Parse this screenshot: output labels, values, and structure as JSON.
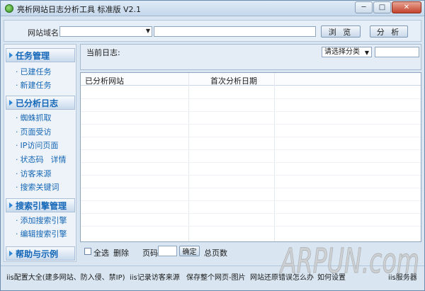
{
  "window": {
    "title": "亮析网站日志分析工具 标准版 V2.1",
    "minimize": "─",
    "maximize": "□",
    "close": "✕"
  },
  "toolbar": {
    "site_label": "网站域名:",
    "site_value": "",
    "browse_label": "浏 览",
    "analyze_label": "分 析"
  },
  "sidebar": {
    "sections": [
      {
        "title": "任务管理",
        "items": [
          "已建任务",
          "新建任务"
        ]
      },
      {
        "title": "已分析日志",
        "items": [
          "蜘蛛抓取",
          "页面受访",
          "IP访问页面",
          "状态码",
          "访客来源",
          "搜索关键词"
        ],
        "extra": "详情"
      },
      {
        "title": "搜索引擎管理",
        "items": [
          "添加搜索引擎",
          "编辑搜索引擎"
        ]
      },
      {
        "title": "帮助与示例",
        "items": []
      }
    ]
  },
  "main": {
    "current_log_label": "当前日志:",
    "category_select": "请选择分类",
    "table": {
      "columns": [
        "已分析网站",
        "首次分析日期"
      ]
    },
    "bottom": {
      "select_all": "全选",
      "delete": "删除",
      "page_label": "页码",
      "ok_label": "确定",
      "total_pages": "总页数"
    }
  },
  "footer": {
    "links": [
      "iis配置大全(建多网站、防入侵、禁IP)",
      "iis记录访客来源",
      "保存整个网页-图片",
      "网站还原错误怎么办",
      "如何设置",
      "iis服务器"
    ]
  },
  "watermark": {
    "text": "ARPUN.com"
  },
  "colors": {
    "accent": "#1366b8",
    "window_bg": "#d9e6f1",
    "border": "#8ea5bf"
  }
}
